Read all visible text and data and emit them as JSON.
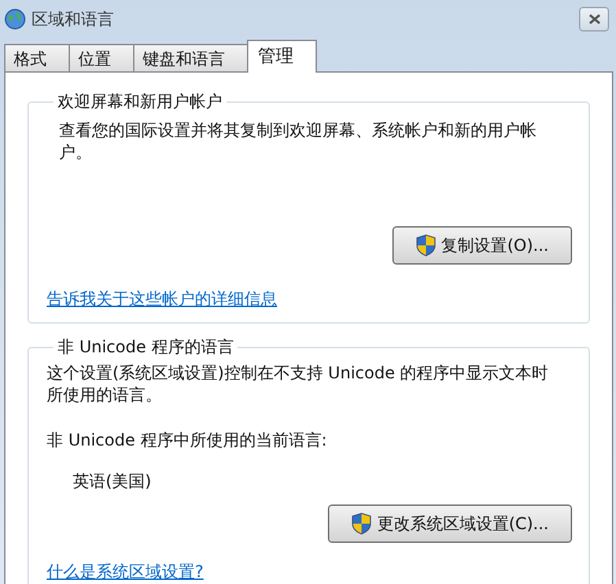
{
  "window": {
    "title": "区域和语言"
  },
  "tabs": [
    {
      "label": "格式",
      "selected": false
    },
    {
      "label": "位置",
      "selected": false
    },
    {
      "label": "键盘和语言",
      "selected": false
    },
    {
      "label": "管理",
      "selected": true
    }
  ],
  "welcome_section": {
    "title": "欢迎屏幕和新用户帐户",
    "description": "查看您的国际设置并将其复制到欢迎屏幕、系统帐户和新的用户帐户。",
    "button": "复制设置(O)...",
    "link": "告诉我关于这些帐户的详细信息"
  },
  "non_unicode_section": {
    "title": "非 Unicode 程序的语言",
    "description": "这个设置(系统区域设置)控制在不支持 Unicode 的程序中显示文本时所使用的语言。",
    "current_label": "非 Unicode 程序中所使用的当前语言:",
    "current_value": "英语(美国)",
    "button": "更改系统区域设置(C)...",
    "link": "什么是系统区域设置?"
  }
}
